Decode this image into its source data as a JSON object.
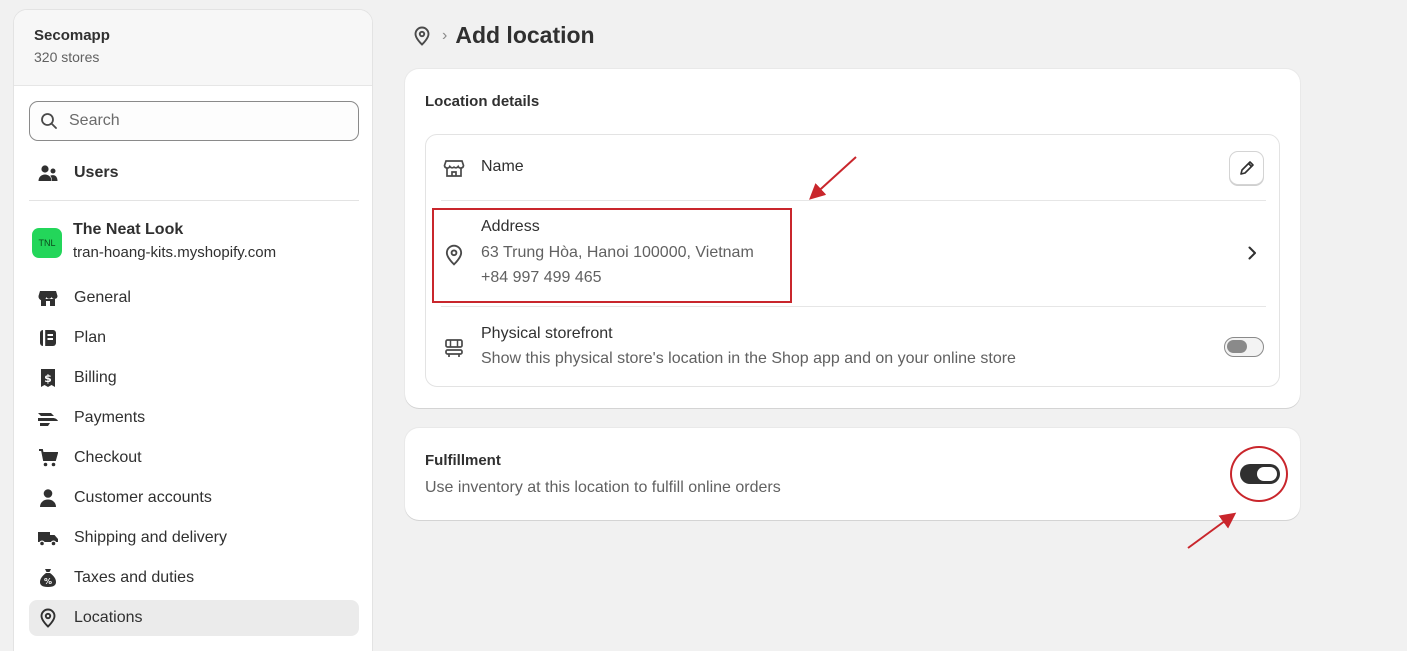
{
  "sidebar": {
    "org": {
      "name": "Secomapp",
      "subtitle": "320 stores"
    },
    "search": {
      "placeholder": "Search",
      "icon": "search-icon"
    },
    "users_label": "Users",
    "store": {
      "initials": "TNL",
      "name": "The Neat Look",
      "domain": "tran-hoang-kits.myshopify.com",
      "avatar_color": "#23d65a"
    },
    "items": [
      {
        "label": "General",
        "icon": "store-icon"
      },
      {
        "label": "Plan",
        "icon": "plan-icon"
      },
      {
        "label": "Billing",
        "icon": "billing-icon"
      },
      {
        "label": "Payments",
        "icon": "payments-icon"
      },
      {
        "label": "Checkout",
        "icon": "cart-icon"
      },
      {
        "label": "Customer accounts",
        "icon": "person-icon"
      },
      {
        "label": "Shipping and delivery",
        "icon": "truck-icon"
      },
      {
        "label": "Taxes and duties",
        "icon": "tax-icon"
      },
      {
        "label": "Locations",
        "icon": "location-icon",
        "active": true
      }
    ]
  },
  "header": {
    "title": "Add location",
    "icon": "location-icon"
  },
  "location_details": {
    "title": "Location details",
    "name_label": "Name",
    "address": {
      "label": "Address",
      "line1": "63 Trung Hòa, Hanoi 100000, Vietnam",
      "phone": "+84 997 499 465"
    },
    "storefront": {
      "label": "Physical storefront",
      "description": "Show this physical store's location in the Shop app and on your online store",
      "enabled": false
    }
  },
  "fulfillment": {
    "title": "Fulfillment",
    "description": "Use inventory at this location to fulfill online orders",
    "enabled": true
  },
  "colors": {
    "annotation": "#c9262c",
    "toggle_on": "#303030",
    "background": "#f1f1f1"
  }
}
